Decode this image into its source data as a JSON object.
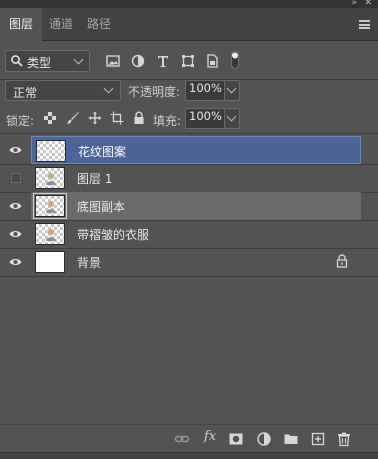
{
  "window": {
    "collapse_icon": "double-chevron-right-icon",
    "close_icon": "close-icon"
  },
  "tabs": [
    {
      "label": "图层",
      "active": true
    },
    {
      "label": "通道",
      "active": false
    },
    {
      "label": "路径",
      "active": false
    }
  ],
  "filter": {
    "kind_label": "类型",
    "icons": [
      "image-filter-icon",
      "adjustment-filter-icon",
      "type-filter-icon",
      "shape-filter-icon",
      "smart-object-filter-icon",
      "filter-toggle-icon"
    ]
  },
  "blend": {
    "mode": "正常",
    "opacity_label": "不透明度:",
    "opacity_value": "100%"
  },
  "lock": {
    "label": "锁定:",
    "icons": [
      "lock-transparent-pixels-icon",
      "lock-image-pixels-icon",
      "lock-position-icon",
      "lock-artboard-icon",
      "lock-all-icon"
    ],
    "fill_label": "填充:",
    "fill_value": "100%"
  },
  "layers": [
    {
      "name": "花纹图案",
      "visible": true,
      "selected": true,
      "thumb": "transparent"
    },
    {
      "name": "图层 1",
      "visible": false,
      "selected": false,
      "thumb": "transparent-figure"
    },
    {
      "name": "底图副本",
      "visible": true,
      "selected": false,
      "hover": true,
      "thumb": "transparent-figure"
    },
    {
      "name": "带褶皱的衣服",
      "visible": true,
      "selected": false,
      "thumb": "transparent-figure"
    },
    {
      "name": "背景",
      "visible": true,
      "selected": false,
      "thumb": "white",
      "locked": true
    }
  ],
  "bottom_bar": {
    "fx_label": "fx",
    "icons": [
      "link-layers-icon",
      "layer-style-icon",
      "layer-mask-icon",
      "adjustment-layer-icon",
      "group-folder-icon",
      "new-layer-icon",
      "delete-layer-icon"
    ]
  },
  "colors": {
    "panel": "#535353",
    "selected": "#4d6499",
    "hover": "#6a6a6a"
  }
}
